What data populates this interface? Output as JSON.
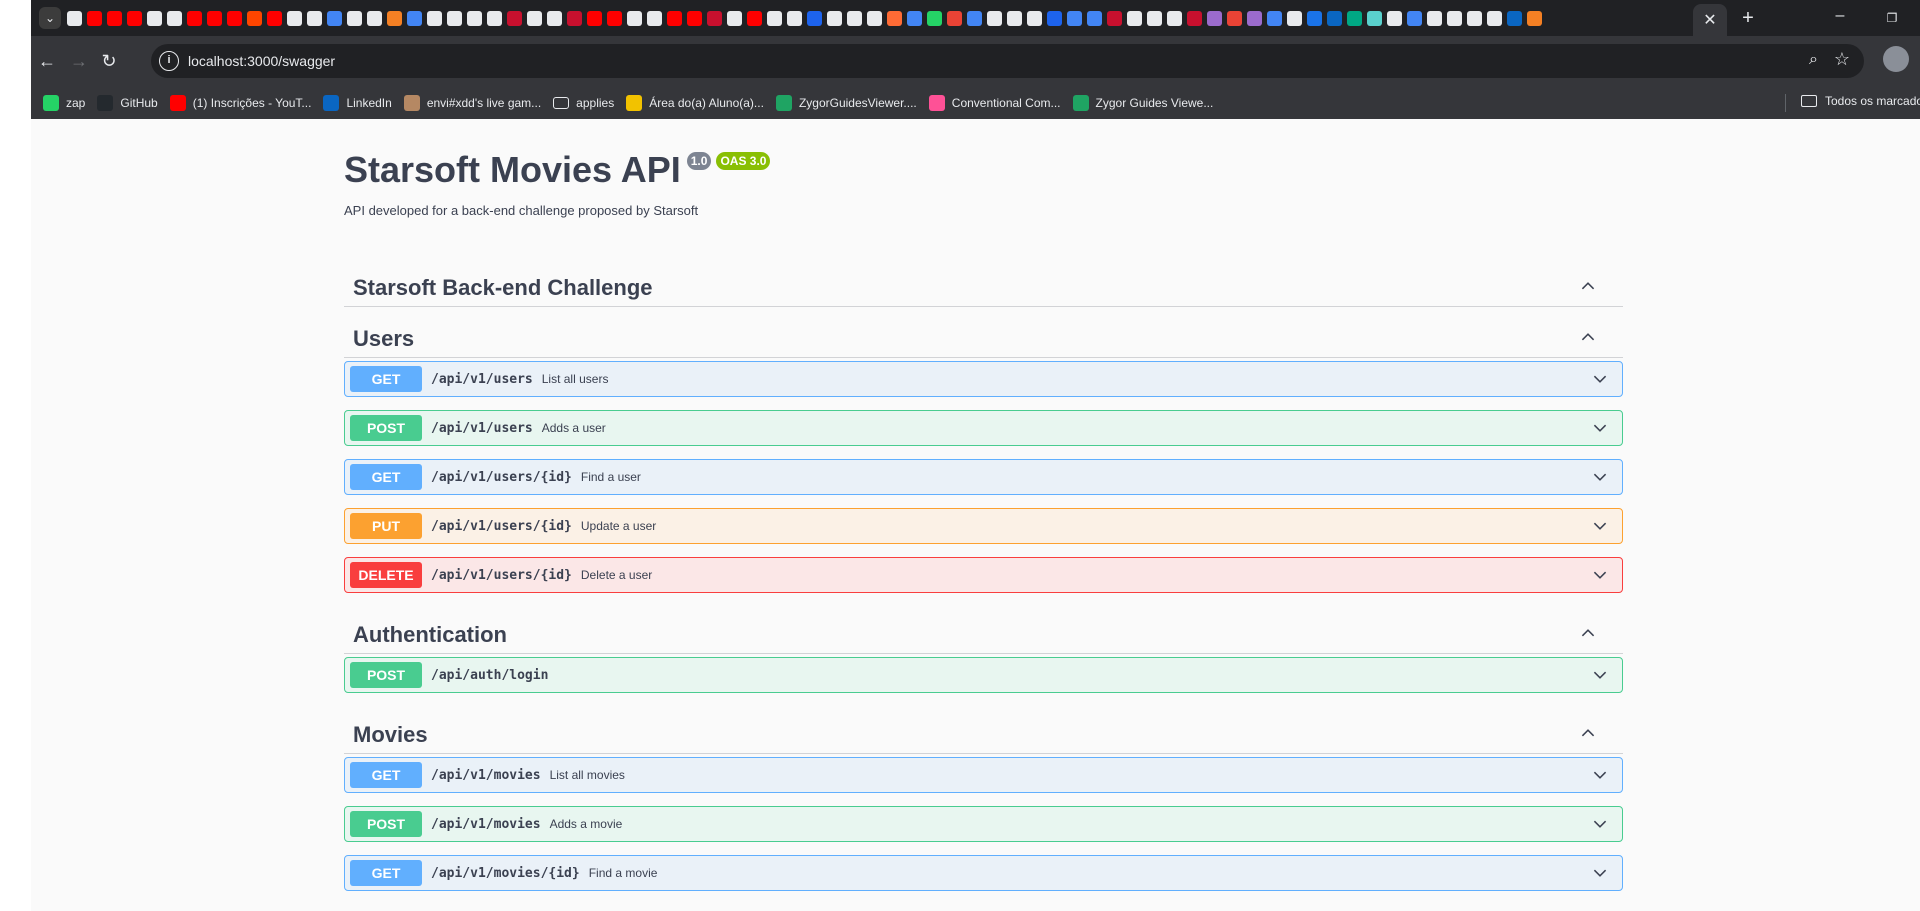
{
  "browser": {
    "tab_close": "✕",
    "new_tab": "+",
    "url": "localhost:3000/swagger",
    "bookmarks": [
      {
        "label": "zap",
        "icon": "whatsapp-icon",
        "color": "#25d366"
      },
      {
        "label": "GitHub",
        "icon": "github-icon",
        "color": "#24292e"
      },
      {
        "label": "(1) Inscrições - YouT...",
        "icon": "youtube-icon",
        "color": "#ff0000"
      },
      {
        "label": "LinkedIn",
        "icon": "linkedin-icon",
        "color": "#0a66c2"
      },
      {
        "label": "envi#xdd's live gam...",
        "icon": "lichess-icon",
        "color": "#b58863"
      },
      {
        "label": "applies",
        "icon": "folder-icon",
        "color": "#e8eaed"
      },
      {
        "label": "Área do(a) Aluno(a)...",
        "icon": "unifor-icon",
        "color": "#f2c200"
      },
      {
        "label": "ZygorGuidesViewer....",
        "icon": "google-drive-icon",
        "color": "#1fa463"
      },
      {
        "label": "Conventional Com...",
        "icon": "conventional-commits-icon",
        "color": "#fe5196"
      },
      {
        "label": "Zygor Guides Viewe...",
        "icon": "google-drive-icon",
        "color": "#1fa463"
      }
    ],
    "all_bookmarks": "Todos os marcado"
  },
  "api": {
    "title": "Starsoft Movies API",
    "version": "1.0",
    "oas": "OAS 3.0",
    "description": "API developed for a back-end challenge proposed by Starsoft"
  },
  "sections": [
    {
      "name": "Starsoft Back-end Challenge",
      "operations": []
    },
    {
      "name": "Users",
      "operations": [
        {
          "method": "GET",
          "path": "/api/v1/users",
          "summary": "List all users"
        },
        {
          "method": "POST",
          "path": "/api/v1/users",
          "summary": "Adds a user"
        },
        {
          "method": "GET",
          "path": "/api/v1/users/{id}",
          "summary": "Find a user"
        },
        {
          "method": "PUT",
          "path": "/api/v1/users/{id}",
          "summary": "Update a user"
        },
        {
          "method": "DELETE",
          "path": "/api/v1/users/{id}",
          "summary": "Delete a user"
        }
      ]
    },
    {
      "name": "Authentication",
      "operations": [
        {
          "method": "POST",
          "path": "/api/auth/login",
          "summary": ""
        }
      ]
    },
    {
      "name": "Movies",
      "operations": [
        {
          "method": "GET",
          "path": "/api/v1/movies",
          "summary": "List all movies"
        },
        {
          "method": "POST",
          "path": "/api/v1/movies",
          "summary": "Adds a movie"
        },
        {
          "method": "GET",
          "path": "/api/v1/movies/{id}",
          "summary": "Find a movie"
        }
      ]
    }
  ],
  "colors": {
    "get": "#61affe",
    "post": "#49cc90",
    "put": "#fca130",
    "delete": "#f93e3e",
    "text": "#3b4151"
  }
}
